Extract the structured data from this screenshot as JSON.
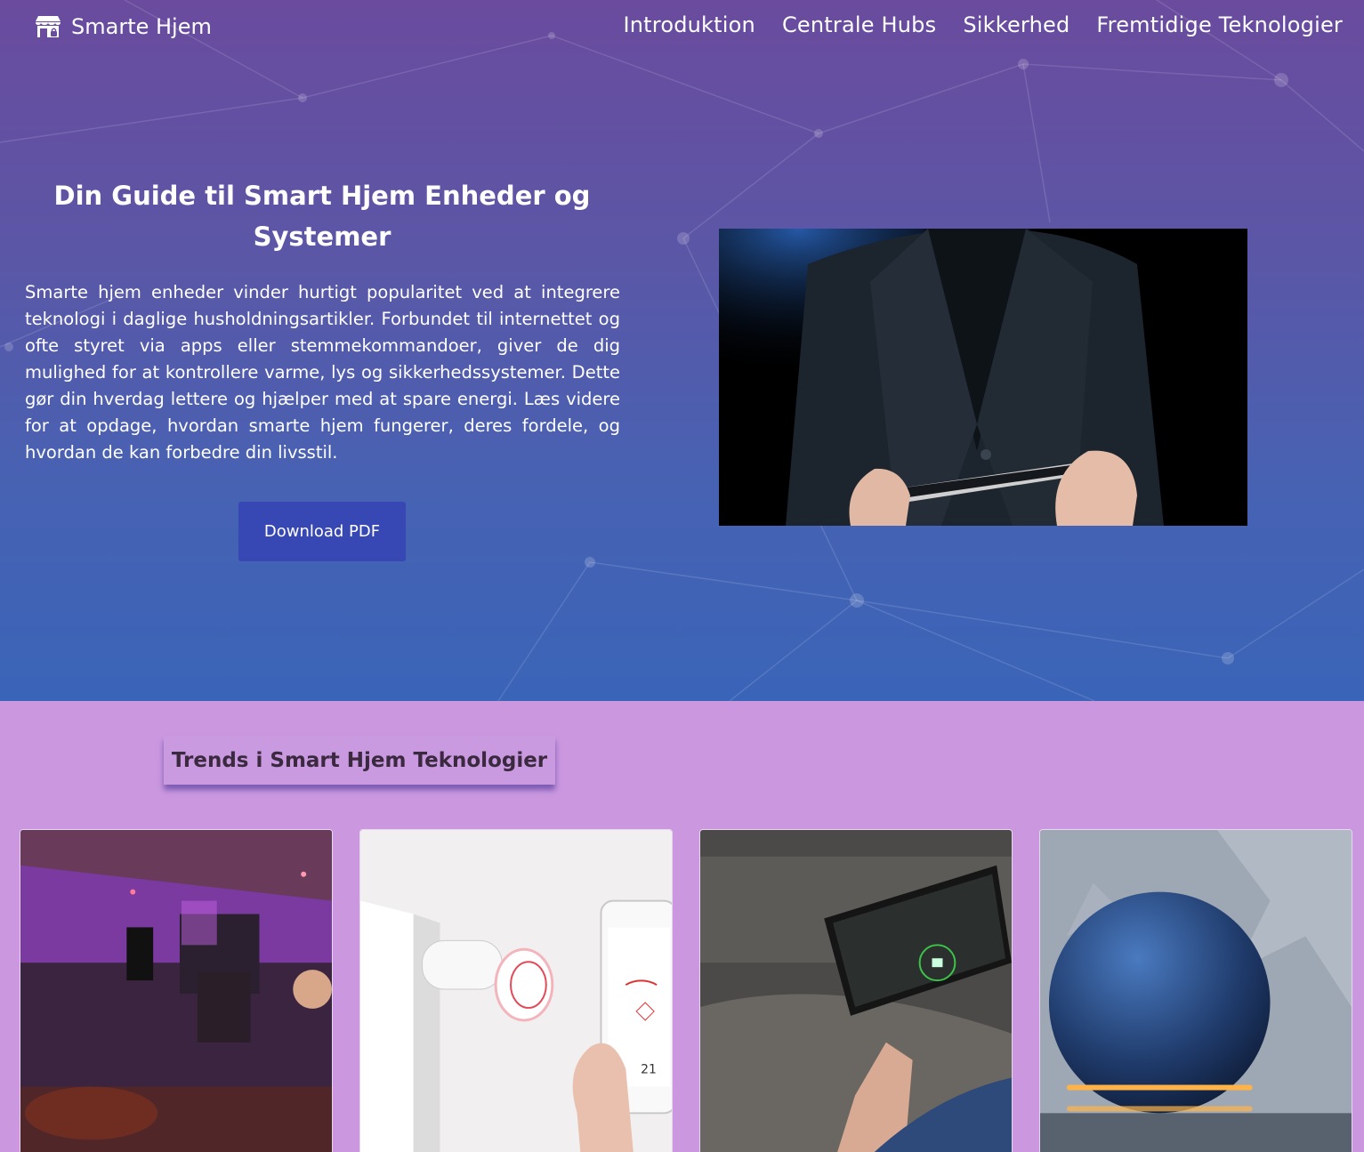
{
  "nav": {
    "brand": "Smarte Hjem",
    "brand_icon": "store-icon",
    "links": [
      "Introduktion",
      "Centrale Hubs",
      "Sikkerhed",
      "Fremtidige Teknologier"
    ]
  },
  "hero": {
    "title": "Din Guide til Smart Hjem Enheder og Systemer",
    "text": "Smarte hjem enheder vinder hurtigt popularitet ved at integrere teknologi i daglige husholdningsartikler. Forbundet til internettet og ofte styret via apps eller stemmekommandoer, giver de dig mulighed for at kontrollere varme, lys og sikkerhedssystemer. Dette gør din hverdag lettere og hjælper med at spare energi. Læs videre for at opdage, hvordan smarte hjem fungerer, deres fordele, og hvordan de kan forbedre din livsstil.",
    "button": "Download PDF"
  },
  "trends": {
    "title": "Trends i Smart Hjem Teknologier"
  },
  "colors": {
    "hero_top": "#6a4b9e",
    "hero_bottom": "#3a64b8",
    "section_bg": "#cb98e0",
    "button_bg": "#3747b3"
  }
}
